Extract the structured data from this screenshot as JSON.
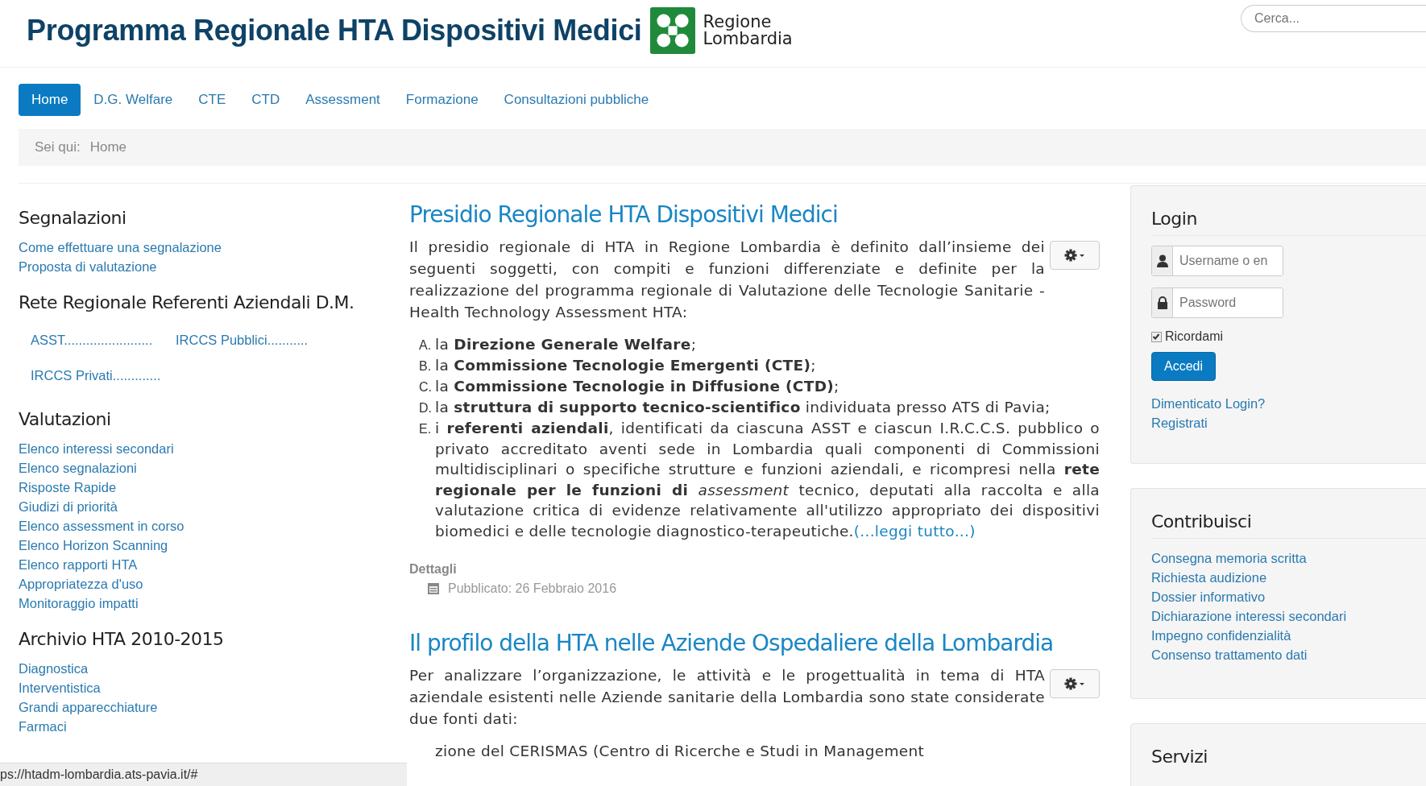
{
  "header": {
    "title": "Programma Regionale HTA Dispositivi Medici",
    "logo_text": [
      "Regione",
      "Lombardia"
    ],
    "search": {
      "placeholder": "Cerca..."
    }
  },
  "nav": [
    {
      "label": "Home",
      "selected": true
    },
    {
      "label": "D.G. Welfare",
      "selected": false
    },
    {
      "label": "CTE",
      "selected": false
    },
    {
      "label": "CTD",
      "selected": false
    },
    {
      "label": "Assessment",
      "selected": false
    },
    {
      "label": "Formazione",
      "selected": false
    },
    {
      "label": "Consultazioni pubbliche",
      "selected": false
    }
  ],
  "breadcrumb": {
    "label": "Sei qui:",
    "items": [
      "Home"
    ]
  },
  "left": [
    {
      "title": "Segnalazioni",
      "kind": "list",
      "links": [
        "Come effettuare una segnalazione",
        "Proposta di valutazione"
      ]
    },
    {
      "title": "Rete Regionale Referenti Aziendali D.M.",
      "kind": "grid",
      "links": [
        "ASST........................",
        "IRCCS Pubblici...........",
        "IRCCS Privati............."
      ]
    },
    {
      "title": "Valutazioni",
      "kind": "list",
      "links": [
        "Elenco interessi secondari",
        "Elenco segnalazioni",
        "Risposte Rapide",
        "Giudizi di priorità",
        "Elenco assessment in corso",
        "Elenco Horizon Scanning",
        "Elenco rapporti HTA",
        "Appropriatezza d'uso",
        "Monitoraggio impatti"
      ]
    },
    {
      "title": "Archivio HTA 2010-2015",
      "kind": "list",
      "links": [
        "Diagnostica",
        "Interventistica",
        "Grandi apparecchiature",
        "Farmaci"
      ]
    }
  ],
  "articles": [
    {
      "title": "Presidio Regionale HTA Dispositivi Medici",
      "intro": "Il presidio regionale di HTA in Regione Lombardia è definito dall’insieme dei seguenti soggetti, con compiti e funzioni differenziate e definite per la realizzazione del programma regionale di Valutazione delle Tecnologie Sanitarie - Health Technology Assessment HTA:",
      "items": [
        {
          "marker": "A.",
          "text": "la **Direzione Generale Welfare**;"
        },
        {
          "marker": "B.",
          "text": "la **Commissione Tecnologie Emergenti (CTE)**;"
        },
        {
          "marker": "C.",
          "text": "la **Commissione Tecnologie in Diffusione (CTD)**;"
        },
        {
          "marker": "D.",
          "text": "la **struttura di supporto tecnico-scientifico** individuata presso ATS di Pavia;"
        },
        {
          "marker": "E.",
          "text": "i **referenti aziendali**, identificati da ciascuna ASST e ciascun I.R.C.C.S. pubblico o privato accreditato aventi sede in Lombardia quali componenti di Commissioni multidisciplinari o specifiche strutture e funzioni aziendali, e ricompresi nella **rete regionale per le funzioni di** *assessment* tecnico, deputati alla raccolta e alla valutazione critica di evidenze relativamente all'utilizzo appropriato dei dispositivi biomedici e delle tecnologie diagnostico-terapeutiche.",
          "link": "(...leggi tutto...)"
        }
      ],
      "details_label": "Dettagli",
      "published": "Pubblicato: 26 Febbraio 2016"
    },
    {
      "title": "Il profilo della HTA nelle Aziende Ospedaliere della Lombardia",
      "intro": "Per analizzare l’organizzazione, le attività e le progettualità in tema di HTA aziendale esistenti nelle Aziende sanitarie della Lombardia sono state considerate due fonti dati:",
      "items": [
        {
          "text": "zione del CERISMAS (Centro di Ricerche e Studi in Management"
        }
      ]
    }
  ],
  "login": {
    "title": "Login",
    "username_placeholder": "Username o en",
    "password_placeholder": "Password",
    "remember": {
      "label": "Ricordami",
      "checked": true
    },
    "button": "Accedi",
    "links": [
      "Dimenticato Login?",
      "Registrati"
    ]
  },
  "contribute": {
    "title": "Contribuisci",
    "links": [
      "Consegna memoria scritta",
      "Richiesta audizione",
      "Dossier informativo",
      "Dichiarazione interessi secondari",
      "Impegno confidenzialità",
      "Consenso trattamento dati"
    ]
  },
  "services": {
    "title": "Servizi"
  },
  "status_bar": "ps://htadm-lombardia.ats-pavia.it/#"
}
